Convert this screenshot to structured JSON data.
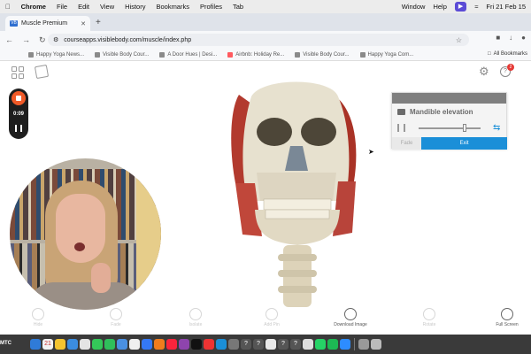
{
  "menubar": {
    "app": "Chrome",
    "items": [
      "File",
      "Edit",
      "View",
      "History",
      "Bookmarks",
      "Profiles",
      "Tab"
    ],
    "window": "Window",
    "help": "Help",
    "clock": "Fri 21 Feb 15"
  },
  "browser": {
    "tab_title": "Muscle Premium",
    "tab_favicon": "VB",
    "url": "courseapps.visiblebody.com/muscle/index.php"
  },
  "bookmarks": {
    "items": [
      "Happy Yoga News...",
      "Visible Body Cour...",
      "A Door Hues | Desi...",
      "Airbnb: Holiday Re...",
      "Visible Body Cour...",
      "Happy Yoga Com..."
    ],
    "all": "All Bookmarks"
  },
  "app": {
    "help_badge": "2",
    "animation": {
      "title": "Mandible elevation",
      "fade_label": "Fade",
      "exit_label": "Exit",
      "progress": 0.74
    },
    "toolbar": [
      "Hide",
      "Fade",
      "Isolate",
      "Add Pin",
      "Download Image",
      "Rotate",
      "Full Screen"
    ]
  },
  "recorder": {
    "time": "0:09"
  },
  "dock": {
    "calendar_date": "21",
    "label": "MTC"
  },
  "colors": {
    "accent": "#1b8fd8",
    "record": "#f05a28",
    "badge": "#e53935"
  }
}
